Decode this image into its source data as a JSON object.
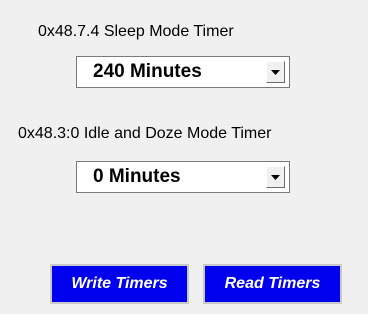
{
  "sleep_timer": {
    "label": "0x48.7.4 Sleep Mode Timer",
    "selected": "240 Minutes"
  },
  "idle_timer": {
    "label": "0x48.3:0 Idle and Doze Mode Timer",
    "selected": "0 Minutes"
  },
  "buttons": {
    "write": "Write Timers",
    "read": "Read Timers"
  },
  "colors": {
    "button_bg": "#0000ee",
    "panel_bg": "#f0f0f0"
  },
  "icons": {
    "dropdown_arrow": "chevron-down-icon"
  }
}
